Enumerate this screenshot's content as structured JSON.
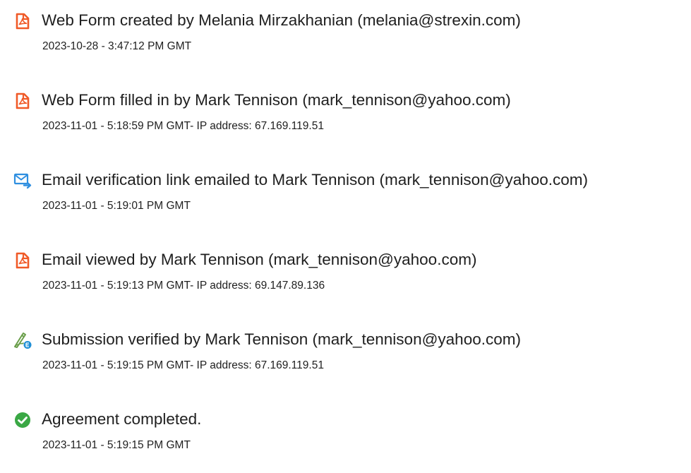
{
  "colors": {
    "pdf_icon": "#f05a28",
    "email_icon": "#2f8fe0",
    "verified_icon": "#6a9e4a",
    "verified_badge": "#1e8fd6",
    "completed_icon": "#3aa845",
    "text": "#1f1f1f"
  },
  "events": [
    {
      "icon": "pdf-document-icon",
      "title": "Web Form created by Melania Mirzakhanian (melania@strexin.com)",
      "timestamp": "2023-10-28 - 3:47:12 PM GMT"
    },
    {
      "icon": "pdf-document-icon",
      "title": "Web Form filled in by Mark Tennison (mark_tennison@yahoo.com)",
      "timestamp": "2023-11-01 - 5:18:59 PM GMT- IP address: 67.169.119.51"
    },
    {
      "icon": "email-send-icon",
      "title": "Email verification link emailed to Mark Tennison (mark_tennison@yahoo.com)",
      "timestamp": "2023-11-01 - 5:19:01 PM GMT"
    },
    {
      "icon": "pdf-document-icon",
      "title": "Email viewed by Mark Tennison (mark_tennison@yahoo.com)",
      "timestamp": "2023-11-01 - 5:19:13 PM GMT- IP address: 69.147.89.136"
    },
    {
      "icon": "signature-verified-icon",
      "title": "Submission verified by Mark Tennison (mark_tennison@yahoo.com)",
      "timestamp": "2023-11-01 - 5:19:15 PM GMT- IP address: 67.169.119.51"
    },
    {
      "icon": "check-circle-icon",
      "title": "Agreement completed.",
      "timestamp": "2023-11-01 - 5:19:15 PM GMT"
    }
  ]
}
